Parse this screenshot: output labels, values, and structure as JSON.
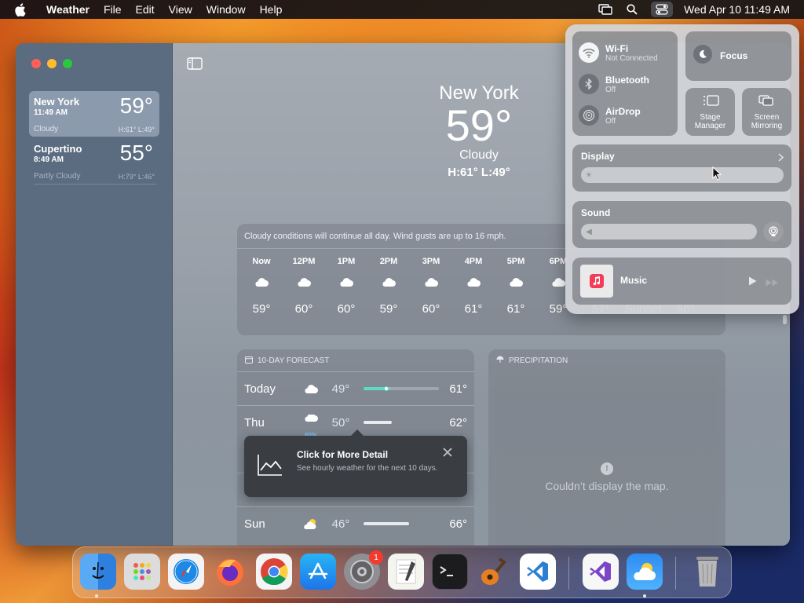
{
  "menubar": {
    "app_name": "Weather",
    "menus": [
      "File",
      "Edit",
      "View",
      "Window",
      "Help"
    ],
    "clock": "Wed Apr 10  11:49 AM"
  },
  "sidebar": {
    "cities": [
      {
        "name": "New York",
        "time": "11:49 AM",
        "temp": "59°",
        "condition": "Cloudy",
        "hilo": "H:61°  L:49°"
      },
      {
        "name": "Cupertino",
        "time": "8:49 AM",
        "temp": "55°",
        "condition": "Partly Cloudy",
        "hilo": "H:79°  L:46°"
      }
    ]
  },
  "hero": {
    "city": "New York",
    "temp": "59°",
    "condition": "Cloudy",
    "hilo": "H:61°  L:49°"
  },
  "hourly": {
    "summary": "Cloudy conditions will continue all day. Wind gusts are up to 16 mph.",
    "hours": [
      {
        "label": "Now",
        "temp": "59°",
        "icon": "cloud-icon"
      },
      {
        "label": "12PM",
        "temp": "60°",
        "icon": "cloud-icon"
      },
      {
        "label": "1PM",
        "temp": "60°",
        "icon": "cloud-icon"
      },
      {
        "label": "2PM",
        "temp": "59°",
        "icon": "cloud-icon"
      },
      {
        "label": "3PM",
        "temp": "60°",
        "icon": "cloud-icon"
      },
      {
        "label": "4PM",
        "temp": "61°",
        "icon": "cloud-icon"
      },
      {
        "label": "5PM",
        "temp": "61°",
        "icon": "cloud-icon"
      },
      {
        "label": "6PM",
        "temp": "59°",
        "icon": "cloud-icon"
      },
      {
        "label": "",
        "temp": "57°",
        "icon": ""
      },
      {
        "label": "",
        "temp": "Sunset",
        "icon": ""
      },
      {
        "label": "",
        "temp": "56°",
        "icon": ""
      }
    ]
  },
  "forecast": {
    "header": "10-DAY FORECAST",
    "days": [
      {
        "day": "Today",
        "lo": "49°",
        "hi": "61°",
        "pct": ""
      },
      {
        "day": "Thu",
        "lo": "50°",
        "hi": "62°",
        "pct": "60%"
      },
      {
        "day": "Sun",
        "lo": "46°",
        "hi": "66°",
        "pct": ""
      }
    ]
  },
  "precipitation": {
    "header": "PRECIPITATION",
    "map_message": "Couldn’t display the map."
  },
  "tooltip": {
    "title": "Click for More Detail",
    "body": "See hourly weather for the next 10 days."
  },
  "control_center": {
    "wifi": {
      "title": "Wi-Fi",
      "status": "Not Connected"
    },
    "bluetooth": {
      "title": "Bluetooth",
      "status": "Off"
    },
    "airdrop": {
      "title": "AirDrop",
      "status": "Off"
    },
    "focus": "Focus",
    "stage_manager": [
      "Stage",
      "Manager"
    ],
    "screen_mirroring": [
      "Screen",
      "Mirroring"
    ],
    "display": "Display",
    "sound": "Sound",
    "music": "Music"
  },
  "colors": {
    "today_bar": "#5ed9c4",
    "thu_bar": "#ffffff",
    "sun_bar": "#ffffff"
  }
}
